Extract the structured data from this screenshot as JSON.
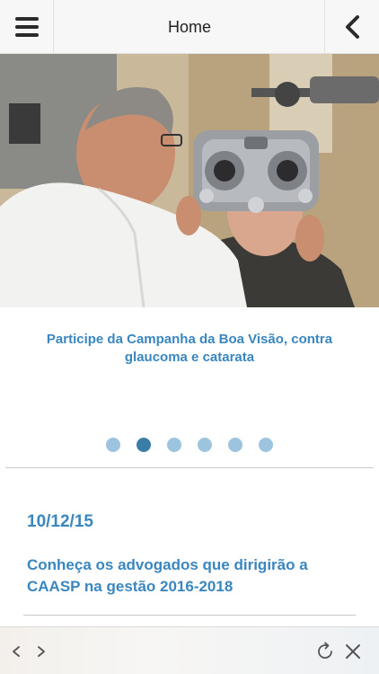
{
  "header": {
    "title": "Home",
    "menu_icon": "hamburger-menu-icon",
    "back_icon": "chevron-left-icon"
  },
  "carousel": {
    "caption": "Participe da Campanha da Boa Visão, contra glaucoma e catarata",
    "slide_count": 6,
    "active_index": 1
  },
  "news": {
    "date": "10/12/15",
    "title": "Conheça os advogados que dirigirão a CAASP na gestão 2016-2018"
  },
  "toolbar": {
    "back_icon": "browser-back-icon",
    "forward_icon": "browser-forward-icon",
    "reload_icon": "reload-icon",
    "close_icon": "close-icon"
  },
  "colors": {
    "accent": "#3a86bf",
    "dot_inactive": "#9dc4de",
    "dot_active": "#3a7ea8"
  }
}
